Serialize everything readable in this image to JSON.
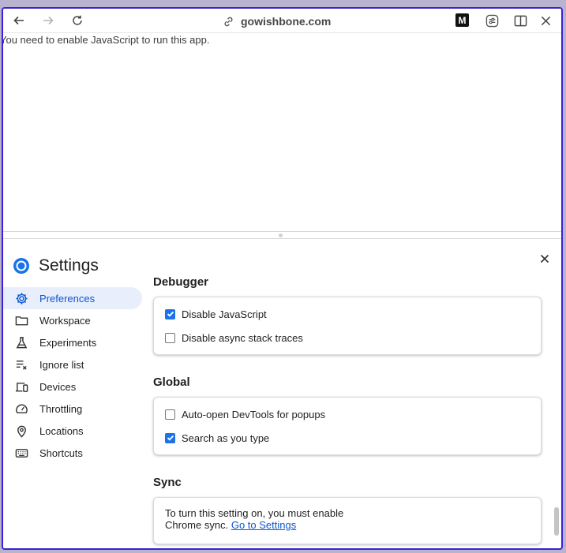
{
  "browser": {
    "url_host": "gowishbone.com",
    "page_message": "You need to enable JavaScript to run this app.",
    "ext_label": "M"
  },
  "settings": {
    "title": "Settings",
    "sidebar": [
      {
        "label": "Preferences",
        "icon": "gear-icon",
        "active": true
      },
      {
        "label": "Workspace",
        "icon": "folder-icon"
      },
      {
        "label": "Experiments",
        "icon": "flask-icon"
      },
      {
        "label": "Ignore list",
        "icon": "ignore-list-icon"
      },
      {
        "label": "Devices",
        "icon": "devices-icon"
      },
      {
        "label": "Throttling",
        "icon": "speedometer-icon"
      },
      {
        "label": "Locations",
        "icon": "location-pin-icon"
      },
      {
        "label": "Shortcuts",
        "icon": "keyboard-icon"
      }
    ],
    "sections": {
      "debugger": {
        "title": "Debugger",
        "options": [
          {
            "label": "Disable JavaScript",
            "checked": true
          },
          {
            "label": "Disable async stack traces",
            "checked": false
          }
        ]
      },
      "global": {
        "title": "Global",
        "options": [
          {
            "label": "Auto-open DevTools for popups",
            "checked": false
          },
          {
            "label": "Search as you type",
            "checked": true
          }
        ]
      },
      "sync": {
        "title": "Sync",
        "text_line1": "To turn this setting on, you must enable",
        "text_line2": "Chrome sync.",
        "link": "Go to Settings"
      }
    }
  },
  "colors": {
    "accent": "#0b57d0",
    "window_border": "#3a22d6",
    "active_bg": "#e8eefb"
  }
}
